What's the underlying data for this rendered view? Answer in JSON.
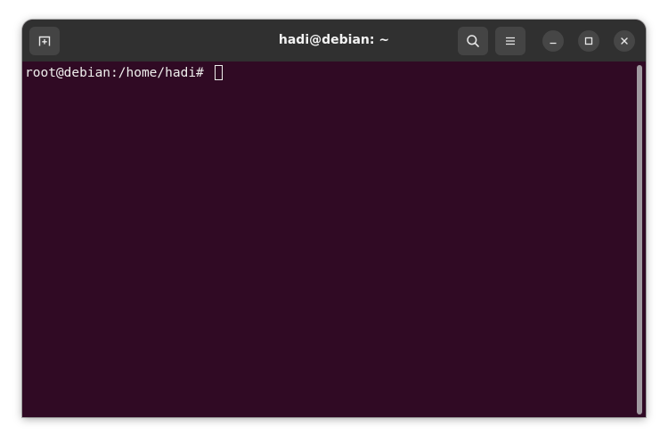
{
  "window": {
    "title": "hadi@debian: ~"
  },
  "titlebar": {
    "new_tab_icon": "new-tab-icon",
    "search_icon": "search-icon",
    "menu_icon": "hamburger-menu-icon",
    "minimize_icon": "minimize-icon",
    "maximize_icon": "maximize-icon",
    "close_icon": "close-icon"
  },
  "terminal": {
    "prompt": "root@debian:/home/hadi#",
    "input": ""
  },
  "colors": {
    "terminal_bg": "#300a24",
    "titlebar_bg": "#303030",
    "text": "#eeeeec"
  }
}
